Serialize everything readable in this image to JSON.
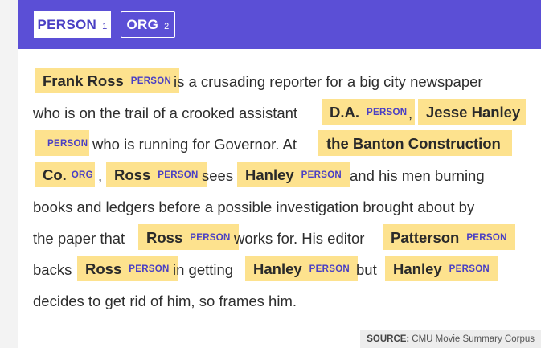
{
  "labels": [
    {
      "name": "PERSON",
      "count": "1"
    },
    {
      "name": "ORG",
      "count": "2"
    }
  ],
  "lines": [
    [
      {
        "t": "ent",
        "text": "Frank Ross",
        "type": "PERSON"
      },
      {
        "t": "txt",
        "text": "is a crusading reporter for a big city newspaper"
      }
    ],
    [
      {
        "t": "txt",
        "text": "who is on the trail of a crooked assistant"
      },
      {
        "t": "ent",
        "text": "D.A.",
        "type": "PERSON"
      },
      {
        "t": "txt",
        "text": ","
      },
      {
        "t": "ent",
        "text": "Jesse Hanley",
        "type": ""
      }
    ],
    [
      {
        "t": "ent",
        "text": "",
        "type": "PERSON"
      },
      {
        "t": "txt",
        "text": "who is running for Governor. At"
      },
      {
        "t": "ent",
        "text": "the Banton Construction",
        "type": ""
      }
    ],
    [
      {
        "t": "ent",
        "text": "Co.",
        "type": "ORG"
      },
      {
        "t": "txt",
        "text": ","
      },
      {
        "t": "ent",
        "text": "Ross",
        "type": "PERSON"
      },
      {
        "t": "txt",
        "text": "sees"
      },
      {
        "t": "ent",
        "text": "Hanley",
        "type": "PERSON"
      },
      {
        "t": "txt",
        "text": "and his men burning"
      }
    ],
    [
      {
        "t": "txt",
        "text": "books and ledgers before a possible investigation brought about by"
      }
    ],
    [
      {
        "t": "txt",
        "text": "the paper that"
      },
      {
        "t": "ent",
        "text": "Ross",
        "type": "PERSON"
      },
      {
        "t": "txt",
        "text": "works for. His editor"
      },
      {
        "t": "ent",
        "text": "Patterson",
        "type": "PERSON"
      }
    ],
    [
      {
        "t": "txt",
        "text": "backs"
      },
      {
        "t": "ent",
        "text": "Ross",
        "type": "PERSON"
      },
      {
        "t": "txt",
        "text": "in getting"
      },
      {
        "t": "ent",
        "text": "Hanley",
        "type": "PERSON"
      },
      {
        "t": "txt",
        "text": "but"
      },
      {
        "t": "ent",
        "text": "Hanley",
        "type": "PERSON"
      }
    ],
    [
      {
        "t": "txt",
        "text": "decides to get rid of him, so frames him."
      }
    ]
  ],
  "source": {
    "label": "SOURCE:",
    "text": "CMU Movie Summary Corpus"
  }
}
